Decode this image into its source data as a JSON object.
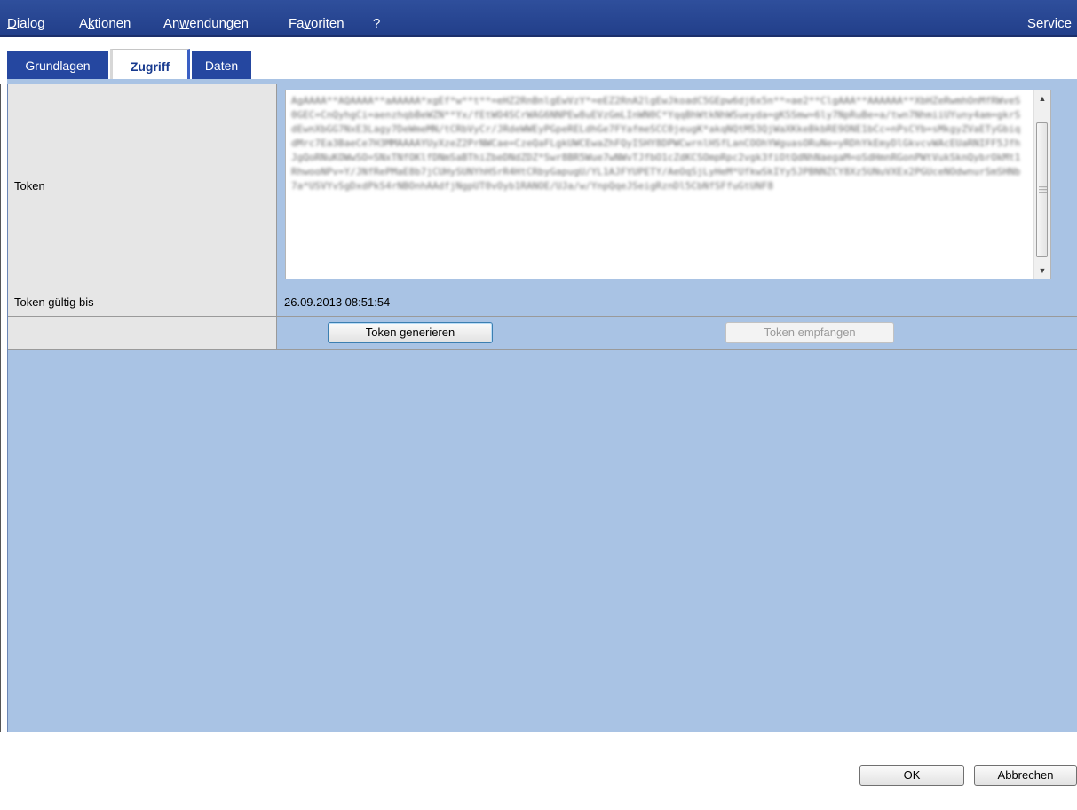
{
  "menu": {
    "items": [
      "Dialog",
      "Aktionen",
      "Anwendungen",
      "Favoriten",
      "?"
    ],
    "service": "Service"
  },
  "tabs": [
    "Grundlagen",
    "Zugriff",
    "Daten"
  ],
  "active_tab": "Zugriff",
  "form": {
    "token_label": "Token",
    "token_value": "AgAAAA**AQAAAA**aAAAAA*xgEf*w**t**=eHZ2RnBnlgEwVzY*=eEZ2RnA2lgEwJkoadC5GEpw6dj6x5n**=ae2**ClgAAA**AAAAAA**XbHZeRwmhOnMfRWveS0GEC=CnQyhgCi=aenzhqbBeWZN**Yx/fEtWO4SCrWAG6NNPEw8uEVzGmLInWN0C*YqqBhWtkNhWSueyda=gKSSmw=6ly7NpRuBe=a/twn7NhmiiUYuny4am=gkrSdEwnXbGG7NxE3Lagy7DeWmeMN/tCRbVyCr/JRdeWWEyPGpeRELdhGe7FYafmeSCC0jeugK*akqNQtMS3QjWaXKkeBkbRE9ONE1bCc=nPsCYb=sMkgyZVaETyGbiqdMrc7Ea3BaeCe7H3MMAAAAYUyXzeZ2PrNWCae=CzeQaFLgkUWCEwaZhFQyISHY8DPWCwrnlHSfLanCOOhYWguasORuNe=yRDhYkEmyDlGkvcvWAcEUaRNIFF5JfhJgQoRNuKOWwSO=SNxTNfOKlfDNmSaBThiZbeDNdZDZ*Swr8BR5Wue7wNWvTJfbO1cZdKCSOmpRpc2vgk3fiOtQdNhNaegaM=oSdHmnRGonPWtVukSknQybrOkMt1RhwooNPv=Y/JNfRePMaE8b7jCUHySUNYhHSrR4HtCRbyGapugU/YL1AJFYUPETY/AeOqSjLyHeM*UfkwSkIYy5JPBNNZCY8Xz5UNuVXEx2PGUceNOdwnurSmSHNb7a*USVYvSgDxdPkS4rNBOnhAAdfjNgpUT0vOyb1RANOE/UJa/w/YnpQqeJSeigRznDl5CbNfSFfuGtUNF8",
    "validity_label": "Token gültig bis",
    "validity_value": "26.09.2013 08:51:54",
    "generate_button": "Token generieren",
    "receive_button": "Token empfangen"
  },
  "footer": {
    "ok_button": "OK",
    "cancel_button": "Abbrechen"
  }
}
